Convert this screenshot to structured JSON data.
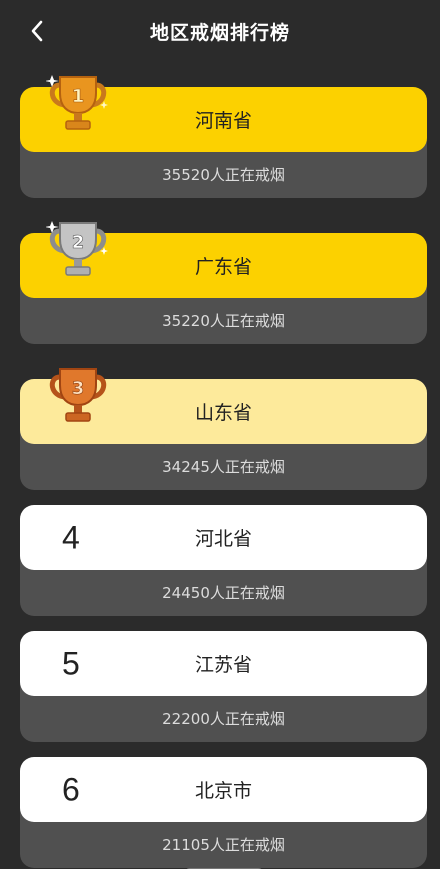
{
  "header": {
    "title": "地区戒烟排行榜"
  },
  "ranking": [
    {
      "rank": "1",
      "name": "河南省",
      "count_text": "35520人正在戒烟",
      "medal": "gold"
    },
    {
      "rank": "2",
      "name": "广东省",
      "count_text": "35220人正在戒烟",
      "medal": "silver"
    },
    {
      "rank": "3",
      "name": "山东省",
      "count_text": "34245人正在戒烟",
      "medal": "bronze"
    },
    {
      "rank": "4",
      "name": "河北省",
      "count_text": "24450人正在戒烟",
      "medal": ""
    },
    {
      "rank": "5",
      "name": "江苏省",
      "count_text": "22200人正在戒烟",
      "medal": ""
    },
    {
      "rank": "6",
      "name": "北京市",
      "count_text": "21105人正在戒烟",
      "medal": ""
    }
  ],
  "colors": {
    "background": "#2b2b2b",
    "gold": "#fcd100",
    "bronze_card": "#fdea9b",
    "card_footer": "#505050"
  }
}
